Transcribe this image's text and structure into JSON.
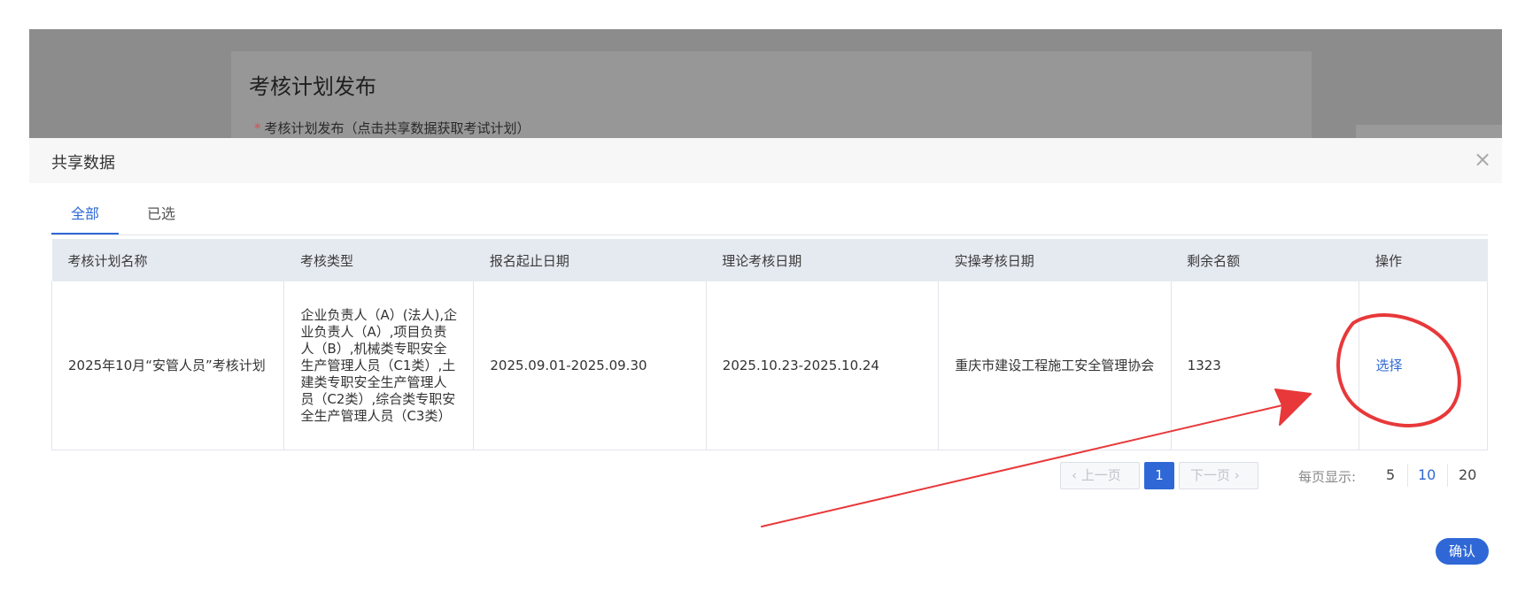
{
  "background_page": {
    "title": "考核计划发布",
    "required_mark": "*",
    "field_label": "考核计划发布（点击共享数据获取考试计划）"
  },
  "modal": {
    "title": "共享数据",
    "close_icon": "close-icon",
    "tabs": [
      {
        "label": "全部",
        "active": true
      },
      {
        "label": "已选",
        "active": false
      }
    ],
    "table": {
      "columns": [
        "考核计划名称",
        "考核类型",
        "报名起止日期",
        "理论考核日期",
        "实操考核日期",
        "剩余名额",
        "操作"
      ],
      "rows": [
        {
          "name": "2025年10月“安管人员”考核计划",
          "type": "企业负责人（A）(法人),企业负责人（A）,项目负责人（B）,机械类专职安全生产管理人员（C1类）,土建类专职安全生产管理人员（C2类）,综合类专职安全生产管理人员（C3类）",
          "signup_dates": "2025.09.01-2025.09.30",
          "theory_date": "2025.10.23-2025.10.24",
          "practice_date": "重庆市建设工程施工安全管理协会",
          "remaining": "1323",
          "action": "选择"
        }
      ]
    },
    "pagination": {
      "prev": "上一页",
      "current": "1",
      "next": "下一页",
      "page_size_label": "每页显示:",
      "sizes": [
        "5",
        "10",
        "20"
      ],
      "selected_size": "10"
    },
    "confirm": "确认"
  },
  "colors": {
    "accent": "#2f68d6",
    "annotation": "#e8383a",
    "overlay": "#8c8c8c"
  }
}
